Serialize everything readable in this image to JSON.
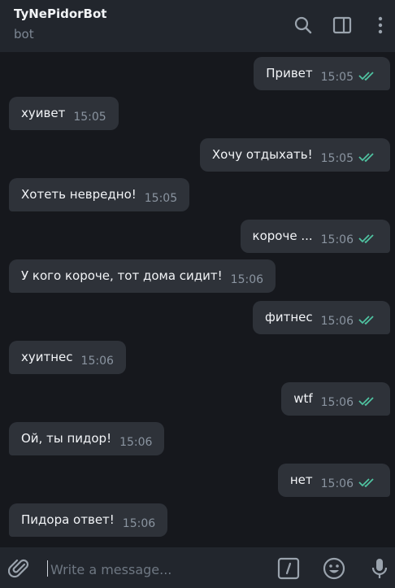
{
  "header": {
    "title": "TyNePidorBot",
    "subtitle": "bot",
    "icons": [
      "search-icon",
      "sidebar-toggle-icon",
      "more-vertical-icon"
    ]
  },
  "messages": [
    {
      "dir": "out",
      "text": "Привет",
      "time": "15:05",
      "read": true
    },
    {
      "dir": "in",
      "text": "хуивет",
      "time": "15:05"
    },
    {
      "dir": "out",
      "text": "Хочу отдыхать!",
      "time": "15:05",
      "read": true
    },
    {
      "dir": "in",
      "text": "Хотеть невредно!",
      "time": "15:05"
    },
    {
      "dir": "out",
      "text": "короче ...",
      "time": "15:06",
      "read": true
    },
    {
      "dir": "in",
      "text": "У кого короче, тот дома сидит!",
      "time": "15:06"
    },
    {
      "dir": "out",
      "text": "фитнес",
      "time": "15:06",
      "read": true
    },
    {
      "dir": "in",
      "text": "хуитнес",
      "time": "15:06"
    },
    {
      "dir": "out",
      "text": "wtf",
      "time": "15:06",
      "read": true
    },
    {
      "dir": "in",
      "text": "Ой, ты пидор!",
      "time": "15:06"
    },
    {
      "dir": "out",
      "text": "нет",
      "time": "15:06",
      "read": true
    },
    {
      "dir": "in",
      "text": "Пидора ответ!",
      "time": "15:06"
    }
  ],
  "composer": {
    "placeholder": "Write a message...",
    "value": "",
    "icons": [
      "attach-icon",
      "commands-icon",
      "emoji-icon",
      "microphone-icon"
    ]
  },
  "colors": {
    "background": "#16181d",
    "header": "#22262d",
    "bubble": "#2e3239",
    "read_ticks": "#4fc3a1",
    "time_text": "#8a94a0",
    "icon": "#9aa3ad"
  }
}
